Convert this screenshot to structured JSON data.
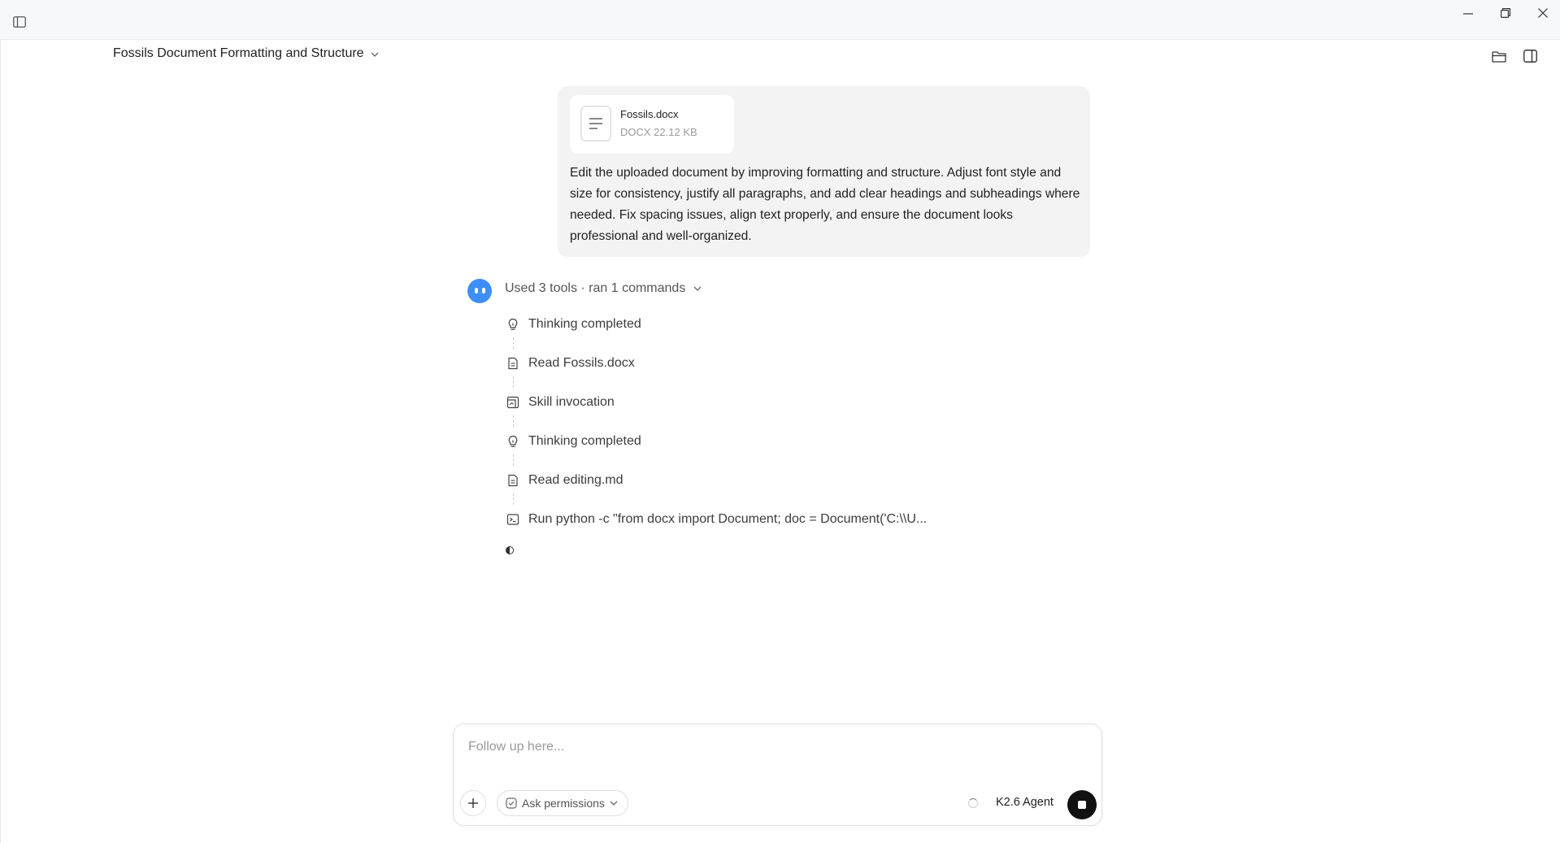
{
  "window": {
    "conversation_title": "Fossils Document Formatting and Structure"
  },
  "user_message": {
    "attachment": {
      "name": "Fossils.docx",
      "meta": "DOCX 22.12 KB"
    },
    "text": "Edit the uploaded document by improving formatting and structure. Adjust font style and size for consistency, justify all paragraphs, and add clear headings and subheadings where needed. Fix spacing issues, align text properly, and ensure the document looks professional and well-organized."
  },
  "agent": {
    "summary": "Used 3 tools · ran 1 commands",
    "steps": [
      {
        "label": "Thinking completed",
        "icon": "lightbulb-icon"
      },
      {
        "label": "Read Fossils.docx",
        "icon": "document-icon"
      },
      {
        "label": "Skill invocation",
        "icon": "skill-icon"
      },
      {
        "label": "Thinking completed",
        "icon": "lightbulb-icon"
      },
      {
        "label": "Read editing.md",
        "icon": "document-icon"
      },
      {
        "label": "Run python -c \"from docx import Document; doc = Document('C:\\\\U...",
        "icon": "terminal-icon"
      }
    ]
  },
  "composer": {
    "placeholder": "Follow up here...",
    "permissions_label": "Ask permissions",
    "model_label": "K2.6 Agent"
  }
}
